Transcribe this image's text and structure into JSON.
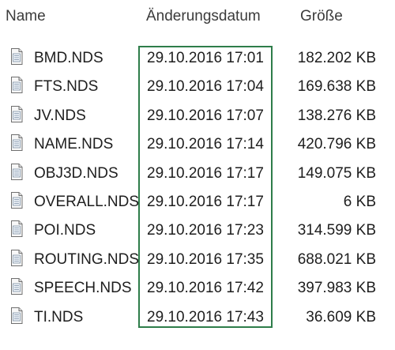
{
  "columns": {
    "name": "Name",
    "date": "Änderungsdatum",
    "size": "Größe"
  },
  "files": [
    {
      "name": "BMD.NDS",
      "date": "29.10.2016 17:01",
      "size": "182.202 KB",
      "icon": "file-icon"
    },
    {
      "name": "FTS.NDS",
      "date": "29.10.2016 17:04",
      "size": "169.638 KB",
      "icon": "file-icon"
    },
    {
      "name": "JV.NDS",
      "date": "29.10.2016 17:07",
      "size": "138.276 KB",
      "icon": "file-icon"
    },
    {
      "name": "NAME.NDS",
      "date": "29.10.2016 17:14",
      "size": "420.796 KB",
      "icon": "file-icon"
    },
    {
      "name": "OBJ3D.NDS",
      "date": "29.10.2016 17:17",
      "size": "149.075 KB",
      "icon": "file-icon"
    },
    {
      "name": "OVERALL.NDS",
      "date": "29.10.2016 17:17",
      "size": "6 KB",
      "icon": "file-icon"
    },
    {
      "name": "POI.NDS",
      "date": "29.10.2016 17:23",
      "size": "314.599 KB",
      "icon": "file-icon"
    },
    {
      "name": "ROUTING.NDS",
      "date": "29.10.2016 17:35",
      "size": "688.021 KB",
      "icon": "file-icon"
    },
    {
      "name": "SPEECH.NDS",
      "date": "29.10.2016 17:42",
      "size": "397.983 KB",
      "icon": "file-icon"
    },
    {
      "name": "TI.NDS",
      "date": "29.10.2016 17:43",
      "size": "36.609 KB",
      "icon": "file-icon"
    }
  ],
  "colors": {
    "highlight_border": "#2e7d4a",
    "header_text": "#3b3b3b",
    "row_text": "#1e1e1e"
  }
}
